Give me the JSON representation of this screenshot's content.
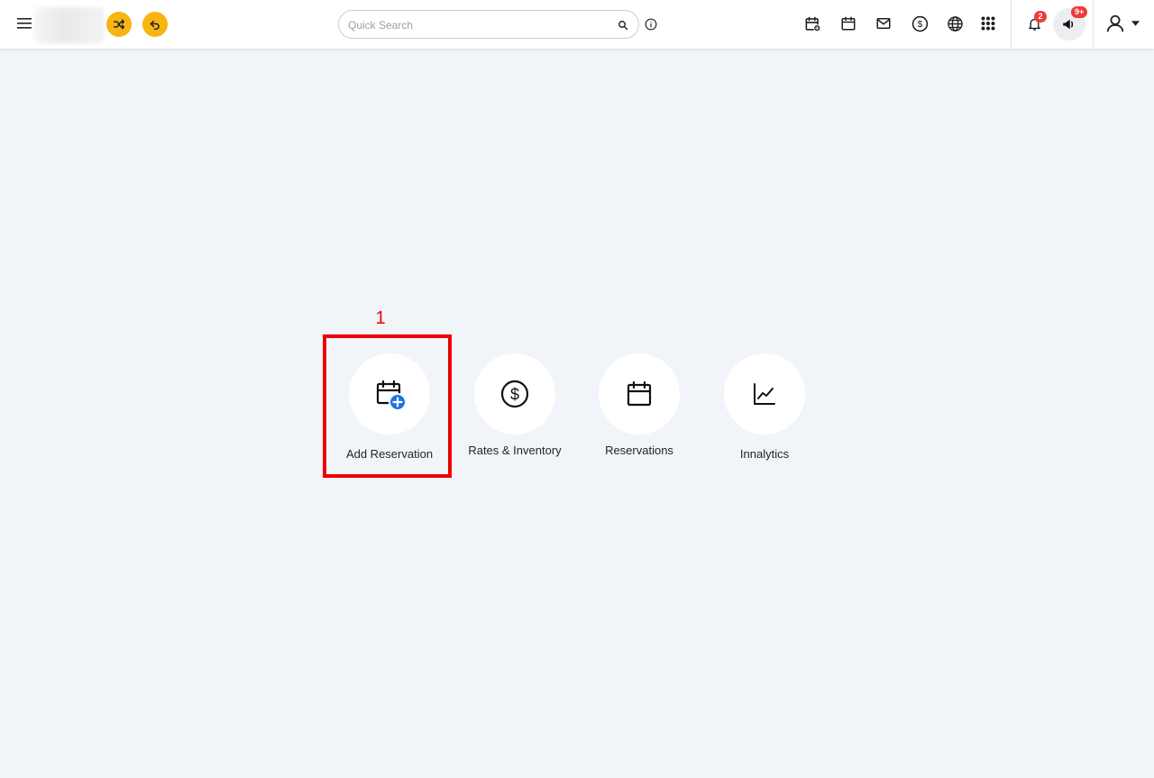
{
  "header": {
    "search": {
      "placeholder": "Quick Search",
      "value": ""
    },
    "icons": [
      "menu-icon",
      "shuffle-icon",
      "undo-icon",
      "search-icon",
      "info-icon",
      "calendar-add-icon",
      "calendar-icon",
      "mail-icon",
      "dollar-icon",
      "globe-icon",
      "apps-grid-icon",
      "bell-icon",
      "megaphone-icon",
      "user-icon",
      "caret-down-icon"
    ],
    "notifications_count": "2",
    "announcements_count": "9+"
  },
  "tiles": [
    {
      "label": "Add Reservation",
      "icon": "calendar-add-icon"
    },
    {
      "label": "Rates & Inventory",
      "icon": "dollar-circle-icon"
    },
    {
      "label": "Reservations",
      "icon": "calendar-icon"
    },
    {
      "label": "Innalytics",
      "icon": "line-chart-icon"
    }
  ],
  "annotation": {
    "step": "1"
  },
  "colors": {
    "accent": "#f7b512",
    "badge": "#ee3b3b",
    "highlight": "#ee0000",
    "plus": "#1a73e8"
  }
}
